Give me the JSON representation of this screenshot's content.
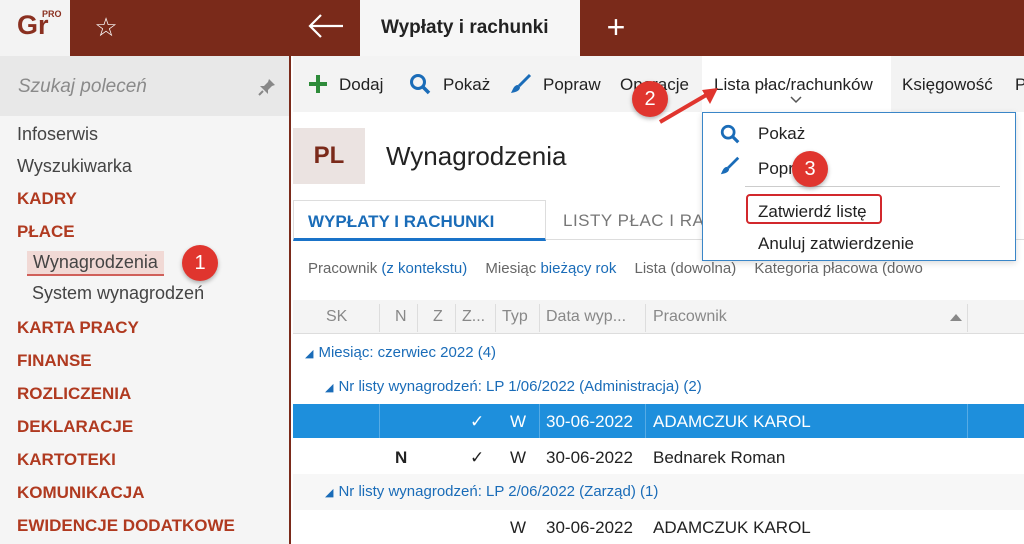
{
  "app": {
    "logo_text": "Gr",
    "logo_badge": "PRO",
    "active_tab": "Wypłaty i rachunki"
  },
  "sidebar": {
    "search_placeholder": "Szukaj poleceń",
    "items": [
      {
        "label": "Infoserwis"
      },
      {
        "label": "Wyszukiwarka"
      },
      {
        "label": "KADRY"
      },
      {
        "label": "PŁACE"
      },
      {
        "label": "Wynagrodzenia"
      },
      {
        "label": "System wynagrodzeń"
      },
      {
        "label": "KARTA PRACY"
      },
      {
        "label": "FINANSE"
      },
      {
        "label": "ROZLICZENIA"
      },
      {
        "label": "DEKLARACJE"
      },
      {
        "label": "KARTOTEKI"
      },
      {
        "label": "KOMUNIKACJA"
      },
      {
        "label": "EWIDENCJE DODATKOWE"
      }
    ]
  },
  "toolbar": {
    "add": "Dodaj",
    "show": "Pokaż",
    "edit": "Popraw",
    "operations": "Operacje",
    "payroll_list": "Lista płac/rachunków",
    "accounting": "Księgowość",
    "cut": "P"
  },
  "header": {
    "badge": "PL",
    "title": "Wynagrodzenia"
  },
  "tabs": {
    "payments": "WYPŁATY I RACHUNKI",
    "lists": "LISTY PŁAC I RA"
  },
  "filters": {
    "employee_label": "Pracownik",
    "employee_value": "(z kontekstu)",
    "month_label": "Miesiąc",
    "month_value": "bieżący rok",
    "list_label": "Lista",
    "list_value": "(dowolna)",
    "category_label": "Kategoria płacowa",
    "category_value": "(dowo"
  },
  "grid": {
    "columns": [
      "SK",
      "N",
      "Z",
      "Z...",
      "Typ",
      "Data wyp...",
      "Pracownik"
    ],
    "groups": [
      {
        "label": "Miesiąc: czerwiec 2022 (4)"
      },
      {
        "label": "Nr listy wynagrodzeń: LP 1/06/2022 (Administracja) (2)"
      },
      {
        "label": "Nr listy wynagrodzeń: LP 2/06/2022 (Zarząd) (1)"
      }
    ],
    "rows": [
      {
        "n": "",
        "z": "✓",
        "typ": "W",
        "date": "30-06-2022",
        "employee": "ADAMCZUK KAROL"
      },
      {
        "n": "N",
        "z": "✓",
        "typ": "W",
        "date": "30-06-2022",
        "employee": "Bednarek Roman"
      },
      {
        "n": "",
        "z": "",
        "typ": "W",
        "date": "30-06-2022",
        "employee": "ADAMCZUK KAROL"
      }
    ]
  },
  "dropdown": {
    "show": "Pokaż",
    "edit": "Popraw",
    "approve": "Zatwierdź listę",
    "cancel": "Anuluj zatwierdzenie"
  },
  "callouts": [
    "1",
    "2",
    "3"
  ],
  "colors": {
    "brand": "#7a2a1a",
    "accent": "#1a6cb8",
    "selection": "#1e8fdc",
    "callout": "#e0352e"
  }
}
